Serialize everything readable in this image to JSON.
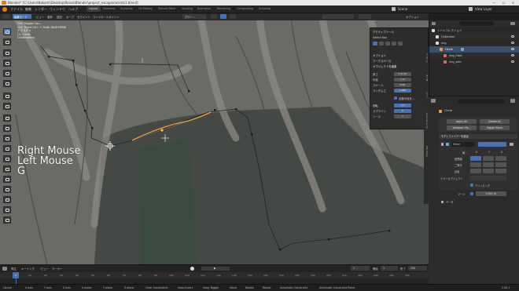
{
  "window": {
    "title": "Blender* [C:\\Users\\Nakami\\Desktop\\Reisei\\Blender\\project_escape\\cw\\roto1.blend]",
    "minimize": "—",
    "maximize": "☐",
    "close": "✕"
  },
  "menubar": {
    "items": [
      "ファイル",
      "編集",
      "レンダー",
      "ウィンドウ",
      "ヘルプ"
    ],
    "workspaces": [
      "Layout",
      "Modeling",
      "Sculpting",
      "UV Editing",
      "Texture Paint",
      "Shading",
      "Animation",
      "Rendering",
      "Compositing",
      "Scripting"
    ],
    "active_workspace": "Layout",
    "scene": "Scene",
    "view_layer": "View Layer"
  },
  "viewport_header": {
    "mode": "編集モード",
    "menus": [
      "ビュー",
      "選択",
      "追加",
      "カーブ",
      "セグメント",
      "コントロールポイント"
    ],
    "transform": "グロー…",
    "options_label": "オプション"
  },
  "overlay_info": {
    "line1": "Ctrl: Toggle Crp...",
    "line2": "Ctrl: Right Ctrl: + Shift: Shift+RMB",
    "line3": "テクスチャ",
    "line4": "(1) Circle",
    "line5": "Centimeters"
  },
  "key_overlay": {
    "line1": "Right Mouse",
    "line2": "Left Mouse",
    "line3": "G"
  },
  "tool_panel": {
    "active_tool": "アクティブツール",
    "tool_name": "Select Box",
    "options": "オプション",
    "workspace": "ワークスペース",
    "object_section": "オブジェクトを編集",
    "rows": [
      {
        "label": "厚さ",
        "value": "1.0 cm"
      },
      {
        "label": "半径",
        "value": "1 m"
      },
      {
        "label": "スケール",
        "value": "0.00"
      },
      {
        "label": "ランダムさ",
        "value": "1.000"
      }
    ],
    "check_label": "自動半径を…",
    "rows2": [
      {
        "label": "回転",
        "value": "1.0"
      },
      {
        "label": "スプライン",
        "value": "6"
      },
      {
        "label": "ソース",
        "value": "1"
      }
    ]
  },
  "npanel_tabs": [
    "アイテム",
    "ツール",
    "ビュー",
    "Animated Line",
    "Edit Mode"
  ],
  "outliner": {
    "header": "シーンコレクション",
    "items": [
      {
        "label": "Collection",
        "indent": 1
      },
      {
        "label": "img",
        "indent": 1
      },
      {
        "label": "Circle",
        "indent": 2,
        "selected": true
      },
      {
        "label": "img_front",
        "indent": 3
      },
      {
        "label": "img_side",
        "indent": 3
      }
    ]
  },
  "properties": {
    "object_name": "Circle",
    "buttons": [
      "Apply All",
      "Delete All",
      "Viewport Vis…",
      "Toggle Stack"
    ],
    "add_modifier": "モディファイアーを追加",
    "modifier_name": "Mirror",
    "axis_label": "軸",
    "axes": [
      "X",
      "Y",
      "Z"
    ],
    "rows": [
      "座標軸",
      "二等分",
      "反転"
    ],
    "mirror_object_label": "ミラーオブジェクト",
    "clipping_label": "クリッピング",
    "merge_label": "マージ",
    "merge_value": "0.001 m",
    "data_label": "データ"
  },
  "timeline": {
    "menus": [
      "再生",
      "キーイング",
      "ビュー",
      "マーカー"
    ],
    "current_frame": "1",
    "start_label": "開始",
    "start": "1",
    "end_label": "終了",
    "end": "250",
    "ticks": [
      "10",
      "20",
      "30",
      "40",
      "50",
      "60",
      "70",
      "80",
      "90",
      "100",
      "110",
      "120",
      "130",
      "140",
      "150",
      "160",
      "170",
      "180",
      "190",
      "200",
      "210",
      "220",
      "230",
      "240",
      "250"
    ]
  },
  "statusbar": {
    "items": [
      "Cancel",
      "X axis",
      "Y axis",
      "Z axis",
      "X plane",
      "Y plane",
      "Z plane",
      "Clear Constraints",
      "Snap Invert",
      "Snap Toggle",
      "Move",
      "Rotate",
      "Resize",
      "Automatic Constraint",
      "Automatic Constraint Plane"
    ],
    "version": "2.90.1"
  },
  "colors": {
    "accent": "#4772b3",
    "curve_selected": "#e8a040",
    "vertex": "#1a1a1a",
    "viewport_bg": "#6a6a67"
  }
}
